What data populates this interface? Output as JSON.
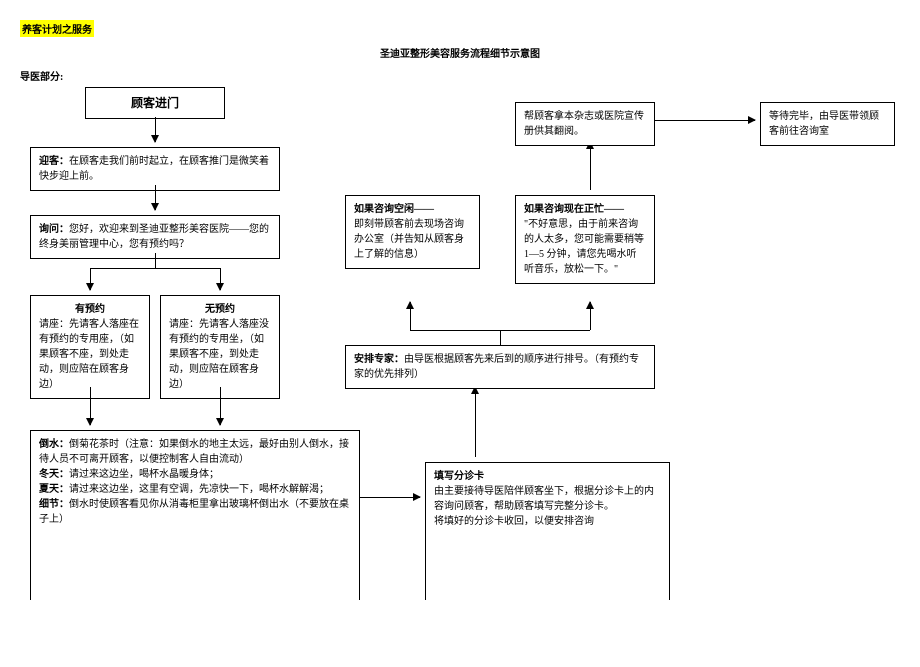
{
  "header": {
    "highlight": "养客计划之服务",
    "title": "圣迪亚整形美容服务流程细节示意图",
    "section": "导医部分:"
  },
  "boxes": {
    "entry": "顾客进门",
    "greet_label": "迎客：",
    "greet_text": "在顾客走我们前时起立，在顾客推门是微笑着快步迎上前。",
    "ask_label": "询问：",
    "ask_text": "您好，欢迎来到圣迪亚整形美容医院——您的终身美丽管理中心，您有预约吗？",
    "booked_title": "有预约",
    "booked_text": "请座：先请客人落座在有预约的专用座，（如果顾客不座，到处走动，则应陪在顾客身边）",
    "nobook_title": "无预约",
    "nobook_text": "请座：先请客人落座没有预约的专用坐，（如果顾客不座，到处走动，则应陪在顾客身边）",
    "water_l1a": "倒水：",
    "water_l1b": "倒菊花茶时（注意：如果倒水的地主太远，最好由别人倒水，接待人员不可离开顾客，以便控制客人自由流动）",
    "water_l2a": "冬天：",
    "water_l2b": "请过来这边坐，喝杯水晶暖身体；",
    "water_l3a": "夏天：",
    "water_l3b": "请过来这边坐，这里有空调，先凉快一下，喝杯水解解渴；",
    "water_l4a": "细节：",
    "water_l4b": "倒水时使顾客看见你从消毒柜里拿出玻璃杯倒出水（不要放在桌子上）",
    "triage_title": "填写分诊卡",
    "triage_l1": "由主要接待导医陪伴顾客坐下，根据分诊卡上的内容询问顾客，帮助顾客填写完整分诊卡。",
    "triage_l2": "将填好的分诊卡收回，以便安排咨询",
    "arrange_label": "安排专家：",
    "arrange_text": "由导医根据顾客先来后到的顺序进行排号。（有预约专家的优先排列）",
    "free_title": "如果咨询空闲——",
    "free_text": "即刻带顾客前去现场咨询办公室（并告知从顾客身上了解的信息）",
    "busy_title": "如果咨询现在正忙——",
    "busy_text": "\"不好意思，由于前来咨询的人太多，您可能需要稍等 1—5 分钟，请您先喝水听听音乐，放松一下。\"",
    "mag": "帮顾客拿本杂志或医院宣传册供其翻阅。",
    "wait": "等待完毕，由导医带领顾客前往咨询室"
  }
}
